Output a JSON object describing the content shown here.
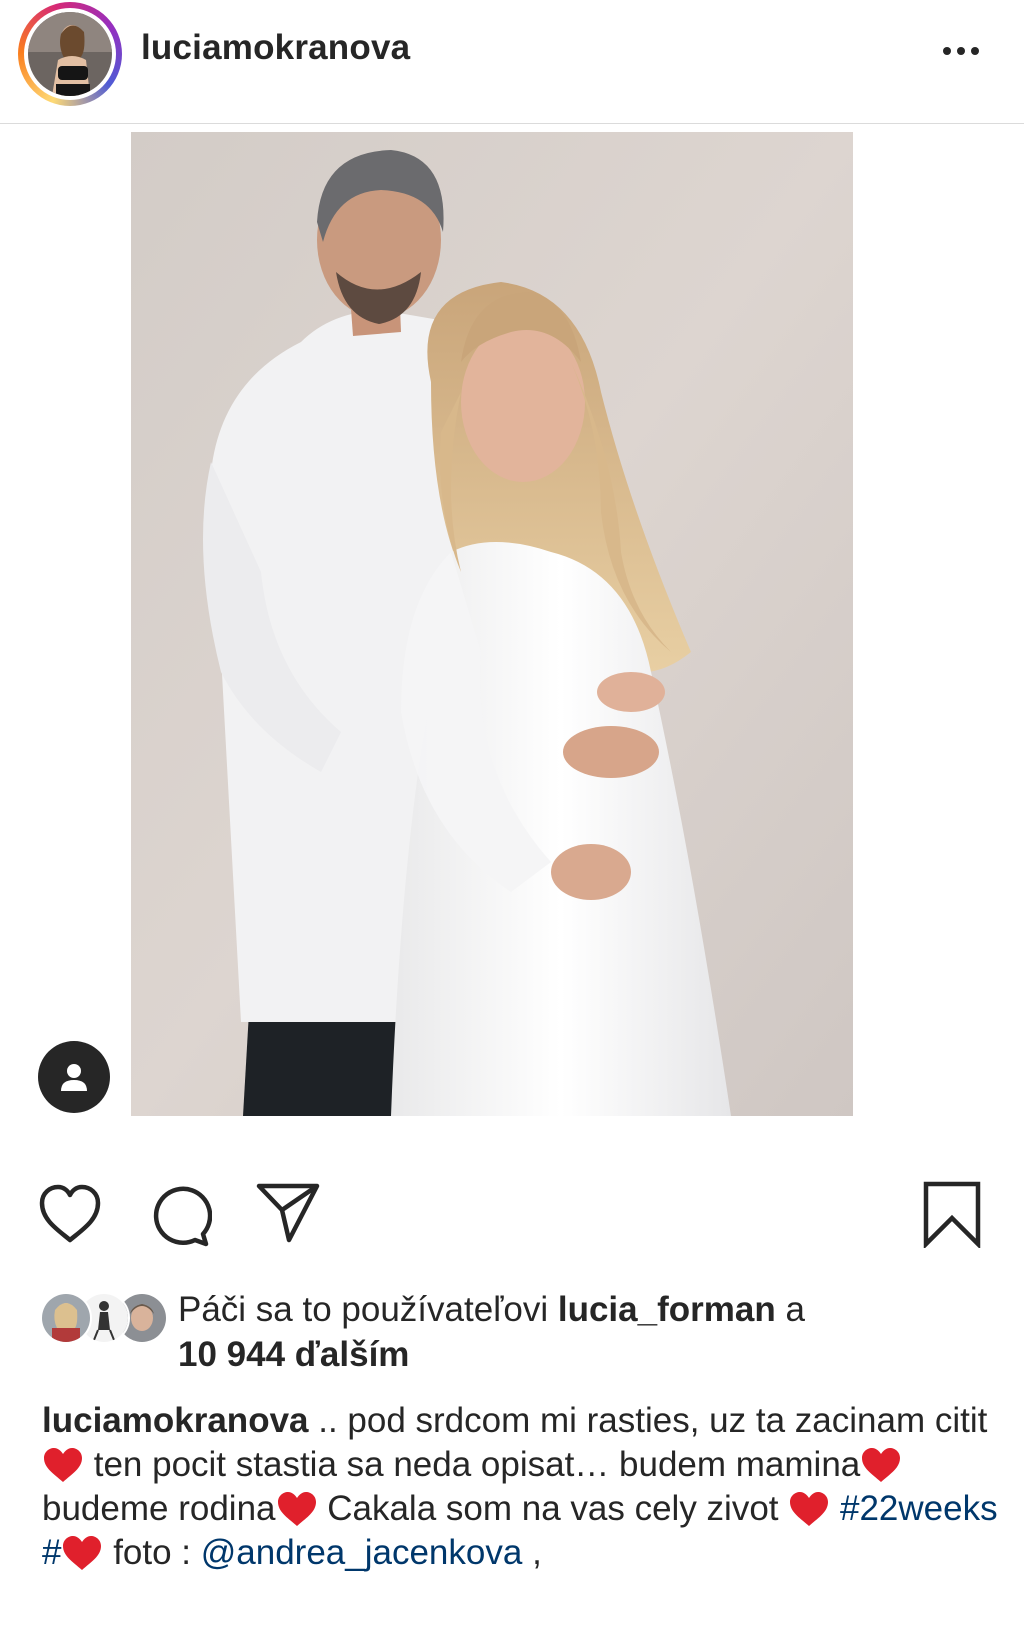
{
  "header": {
    "username": "luciamokranova",
    "more_icon": "more-horizontal-icon"
  },
  "post": {
    "photo_description": "",
    "tag_icon": "user-icon"
  },
  "actions": {
    "like_icon": "heart-outline-icon",
    "comment_icon": "comment-icon",
    "share_icon": "paper-plane-icon",
    "save_icon": "bookmark-icon"
  },
  "likes": {
    "prefix": "Páči sa to používateľovi ",
    "user": "lucia_forman",
    "connector": " a",
    "count_text": "10 944 ďalším"
  },
  "caption": {
    "username": "luciamokranova",
    "part1": " .. pod srdcom mi rasties, uz ta zacinam citit ",
    "part2": " ten pocit stastia sa neda opisat… budem mamina",
    "part3": "budeme rodina",
    "part4": " Cakala som na vas cely zivot ",
    "hashtag": " #22weeks #",
    "part5": " foto : ",
    "mention": "@andrea_jacenkova",
    "tail": " ,"
  },
  "colors": {
    "text": "#262626",
    "link": "#00376b",
    "heart_emoji": "#e0202c",
    "divider": "#dbdbdb"
  }
}
